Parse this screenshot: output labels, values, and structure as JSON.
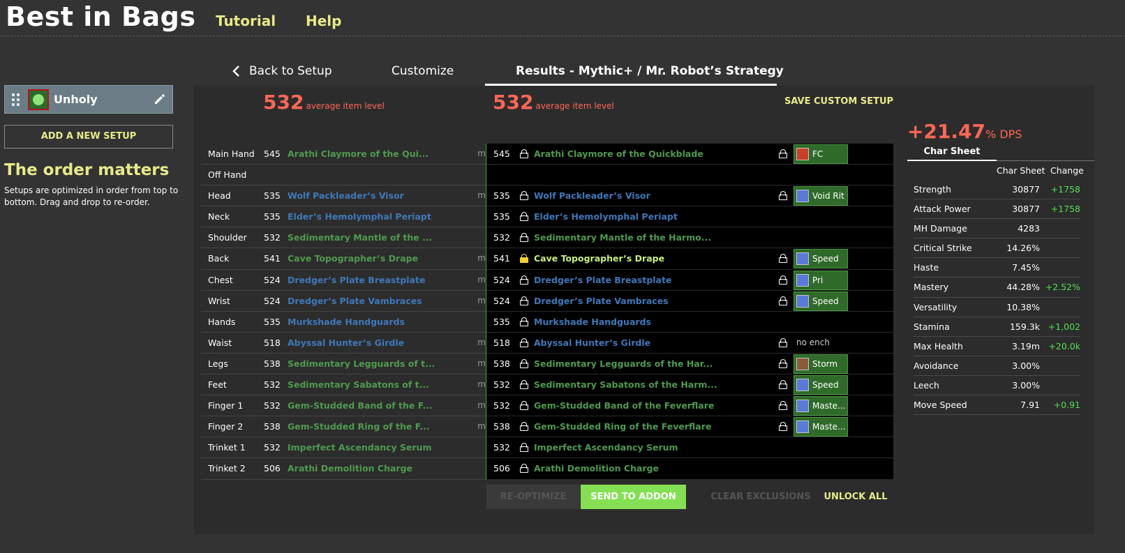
{
  "header": {
    "brand": "Best in Bags",
    "nav": [
      {
        "label": "Tutorial"
      },
      {
        "label": "Help"
      }
    ]
  },
  "sidebar": {
    "setup_name": "Unholy",
    "add_setup_label": "ADD A NEW SETUP",
    "order_title": "The order matters",
    "order_text": "Setups are optimized in order from top to bottom. Drag and drop to re-order."
  },
  "tabs": {
    "back": "Back to Setup",
    "customize": "Customize",
    "results": "Results - Mythic+ / Mr. Robot’s Strategy"
  },
  "summary": {
    "left_ilvl": "532",
    "right_ilvl": "532",
    "ilvl_label": "average item level",
    "save_custom": "SAVE CUSTOM SETUP",
    "dps_gain": "+21.47",
    "dps_unit": "% DPS"
  },
  "gear_left": [
    {
      "slot": "Main Hand",
      "lvl": "545",
      "name": "Arathi Claymore of the Qui...",
      "color": "green",
      "m": "m"
    },
    {
      "slot": "Off Hand",
      "lvl": "",
      "name": "",
      "color": "green",
      "m": ""
    },
    {
      "slot": "Head",
      "lvl": "535",
      "name": "Wolf Packleader’s Visor",
      "color": "blue",
      "m": "m"
    },
    {
      "slot": "Neck",
      "lvl": "535",
      "name": "Elder’s Hemolymphal Periapt",
      "color": "blue",
      "m": ""
    },
    {
      "slot": "Shoulder",
      "lvl": "532",
      "name": "Sedimentary Mantle of the ...",
      "color": "green",
      "m": ""
    },
    {
      "slot": "Back",
      "lvl": "541",
      "name": "Cave Topographer’s Drape",
      "color": "green",
      "m": "m"
    },
    {
      "slot": "Chest",
      "lvl": "524",
      "name": "Dredger’s Plate Breastplate",
      "color": "blue",
      "m": "m"
    },
    {
      "slot": "Wrist",
      "lvl": "524",
      "name": "Dredger’s Plate Vambraces",
      "color": "blue",
      "m": "m"
    },
    {
      "slot": "Hands",
      "lvl": "535",
      "name": "Murkshade Handguards",
      "color": "blue",
      "m": ""
    },
    {
      "slot": "Waist",
      "lvl": "518",
      "name": "Abyssal Hunter’s Girdle",
      "color": "blue",
      "m": "m"
    },
    {
      "slot": "Legs",
      "lvl": "538",
      "name": "Sedimentary Legguards of t...",
      "color": "green",
      "m": "m"
    },
    {
      "slot": "Feet",
      "lvl": "532",
      "name": "Sedimentary Sabatons of t...",
      "color": "green",
      "m": "m"
    },
    {
      "slot": "Finger 1",
      "lvl": "532",
      "name": "Gem-Studded Band of the F...",
      "color": "green",
      "m": "m"
    },
    {
      "slot": "Finger 2",
      "lvl": "538",
      "name": "Gem-Studded Ring of the F...",
      "color": "green",
      "m": "m"
    },
    {
      "slot": "Trinket 1",
      "lvl": "532",
      "name": "Imperfect Ascendancy Serum",
      "color": "green",
      "m": ""
    },
    {
      "slot": "Trinket 2",
      "lvl": "506",
      "name": "Arathi Demolition Charge",
      "color": "green",
      "m": ""
    }
  ],
  "gear_right": [
    {
      "lvl": "545",
      "name": "Arathi Claymore of the Quickblade",
      "color": "green",
      "gold": false,
      "lock2": true,
      "ench": "FC",
      "ench_icon": "#c8402a",
      "noench": ""
    },
    {
      "lvl": "",
      "name": "",
      "color": "green",
      "gold": false,
      "lock2": false,
      "ench": "",
      "ench_icon": "",
      "noench": ""
    },
    {
      "lvl": "535",
      "name": "Wolf Packleader’s Visor",
      "color": "blue",
      "gold": false,
      "lock2": true,
      "ench": "Void Rit",
      "ench_icon": "#5a7ad8",
      "noench": ""
    },
    {
      "lvl": "535",
      "name": "Elder’s Hemolymphal Periapt",
      "color": "blue",
      "gold": false,
      "lock2": false,
      "ench": "",
      "ench_icon": "",
      "noench": ""
    },
    {
      "lvl": "532",
      "name": "Sedimentary Mantle of the Harmo...",
      "color": "green",
      "gold": false,
      "lock2": false,
      "ench": "",
      "ench_icon": "",
      "noench": ""
    },
    {
      "lvl": "541",
      "name": "Cave Topographer’s Drape",
      "color": "yellowgreen",
      "gold": true,
      "lock2": true,
      "ench": "Speed",
      "ench_icon": "#5a7ad8",
      "noench": ""
    },
    {
      "lvl": "524",
      "name": "Dredger’s Plate Breastplate",
      "color": "blue",
      "gold": false,
      "lock2": true,
      "ench": "Pri",
      "ench_icon": "#5a7ad8",
      "noench": ""
    },
    {
      "lvl": "524",
      "name": "Dredger’s Plate Vambraces",
      "color": "blue",
      "gold": false,
      "lock2": true,
      "ench": "Speed",
      "ench_icon": "#5a7ad8",
      "noench": ""
    },
    {
      "lvl": "535",
      "name": "Murkshade Handguards",
      "color": "blue",
      "gold": false,
      "lock2": false,
      "ench": "",
      "ench_icon": "",
      "noench": ""
    },
    {
      "lvl": "518",
      "name": "Abyssal Hunter’s Girdle",
      "color": "blue",
      "gold": false,
      "lock2": true,
      "ench": "",
      "ench_icon": "",
      "noench": "no ench"
    },
    {
      "lvl": "538",
      "name": "Sedimentary Legguards of the Har...",
      "color": "green",
      "gold": false,
      "lock2": true,
      "ench": "Storm",
      "ench_icon": "#8a5a3a",
      "noench": ""
    },
    {
      "lvl": "532",
      "name": "Sedimentary Sabatons of the Harm...",
      "color": "green",
      "gold": false,
      "lock2": true,
      "ench": "Speed",
      "ench_icon": "#5a7ad8",
      "noench": ""
    },
    {
      "lvl": "532",
      "name": "Gem-Studded Band of the Feverflare",
      "color": "green",
      "gold": false,
      "lock2": true,
      "ench": "Maste...",
      "ench_icon": "#5a7ad8",
      "noench": ""
    },
    {
      "lvl": "538",
      "name": "Gem-Studded Ring of the Feverflare",
      "color": "green",
      "gold": false,
      "lock2": true,
      "ench": "Maste...",
      "ench_icon": "#5a7ad8",
      "noench": ""
    },
    {
      "lvl": "532",
      "name": "Imperfect Ascendancy Serum",
      "color": "green",
      "gold": false,
      "lock2": false,
      "ench": "",
      "ench_icon": "",
      "noench": ""
    },
    {
      "lvl": "506",
      "name": "Arathi Demolition Charge",
      "color": "green",
      "gold": false,
      "lock2": false,
      "ench": "",
      "ench_icon": "",
      "noench": ""
    }
  ],
  "buttons": {
    "reoptimize": "RE-OPTIMIZE",
    "send": "SEND TO ADDON",
    "clear": "CLEAR EXCLUSIONS",
    "unlock": "UNLOCK ALL"
  },
  "stats": {
    "tab_label": "Char Sheet",
    "col_value": "Char Sheet",
    "col_change": "Change",
    "rows": [
      {
        "name": "Strength",
        "value": "30877",
        "change": "+1758"
      },
      {
        "name": "Attack Power",
        "value": "30877",
        "change": "+1758"
      },
      {
        "name": "MH Damage",
        "value": "4283",
        "change": ""
      },
      {
        "name": "Critical Strike",
        "value": "14.26%",
        "change": ""
      },
      {
        "name": "Haste",
        "value": "7.45%",
        "change": ""
      },
      {
        "name": "Mastery",
        "value": "44.28%",
        "change": "+2.52%"
      },
      {
        "name": "Versatility",
        "value": "10.38%",
        "change": ""
      },
      {
        "name": "Stamina",
        "value": "159.3k",
        "change": "+1,002"
      },
      {
        "name": "Max Health",
        "value": "3.19m",
        "change": "+20.0k"
      },
      {
        "name": "Avoidance",
        "value": "3.00%",
        "change": ""
      },
      {
        "name": "Leech",
        "value": "3.00%",
        "change": ""
      },
      {
        "name": "Move Speed",
        "value": "7.91",
        "change": "+0.91"
      }
    ]
  }
}
